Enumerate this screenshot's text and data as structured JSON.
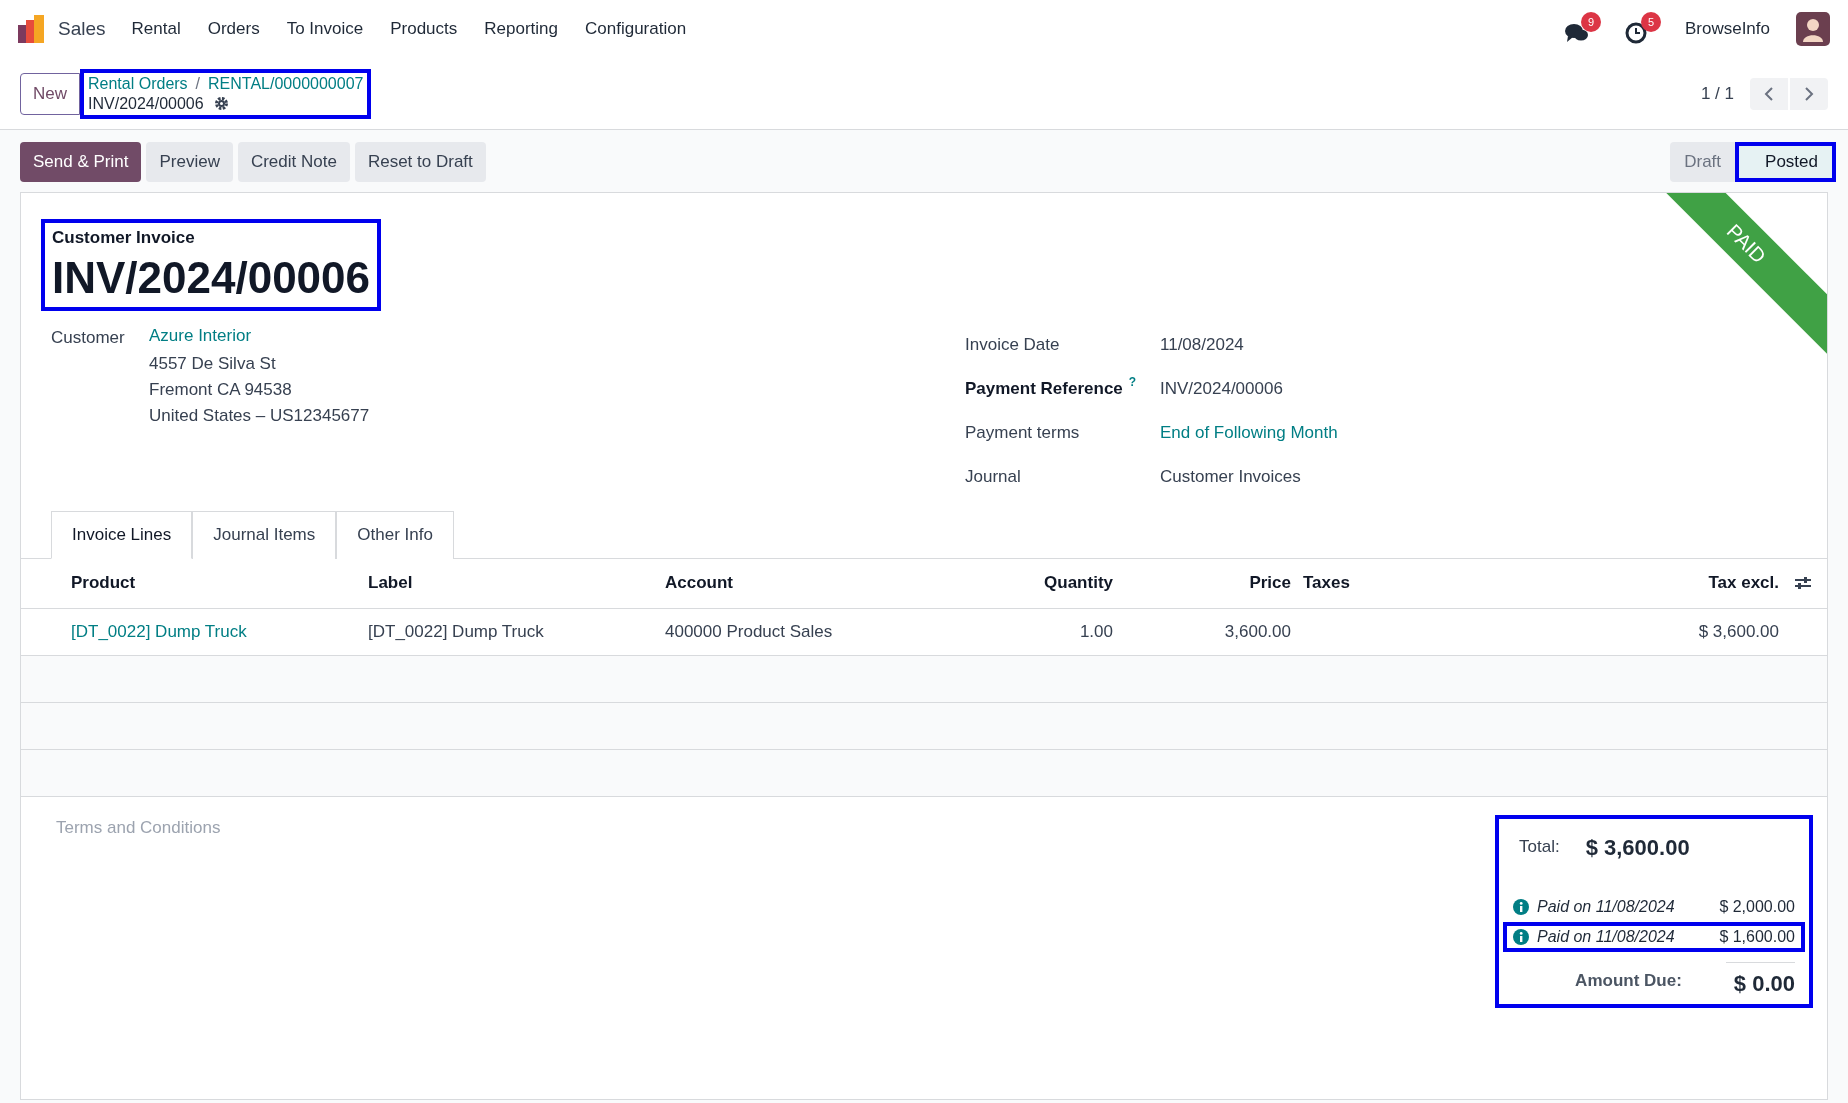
{
  "navbar": {
    "app": "Sales",
    "menu": [
      "Rental",
      "Orders",
      "To Invoice",
      "Products",
      "Reporting",
      "Configuration"
    ],
    "messages_count": "9",
    "activities_count": "5",
    "user": "BrowseInfo"
  },
  "control_panel": {
    "new_button": "New",
    "breadcrumbs": [
      "Rental Orders",
      "RENTAL/0000000007"
    ],
    "separator": "/",
    "current": "INV/2024/00006",
    "pager": "1 / 1"
  },
  "actions": [
    {
      "label": "Send & Print",
      "primary": true
    },
    {
      "label": "Preview",
      "primary": false
    },
    {
      "label": "Credit Note",
      "primary": false
    },
    {
      "label": "Reset to Draft",
      "primary": false
    }
  ],
  "status_bar": [
    {
      "label": "Draft",
      "selected": false
    },
    {
      "label": "Posted",
      "selected": true
    }
  ],
  "ribbon": "PAID",
  "document": {
    "type": "Customer Invoice",
    "number": "INV/2024/00006"
  },
  "customer": {
    "label": "Customer",
    "name": "Azure Interior",
    "address": [
      "4557 De Silva St",
      "Fremont CA 94538",
      "United States – US12345677"
    ]
  },
  "fields": [
    {
      "label": "Invoice Date",
      "value": "11/08/2024",
      "link": false,
      "required": false
    },
    {
      "label": "Payment Reference",
      "help": "?",
      "value": "INV/2024/00006",
      "link": false,
      "required": true
    },
    {
      "label": "Payment terms",
      "value": "End of Following Month",
      "link": true,
      "required": false
    },
    {
      "label": "Journal",
      "value": "Customer Invoices",
      "link": false,
      "required": false
    }
  ],
  "tabs": [
    {
      "label": "Invoice Lines",
      "selected": true
    },
    {
      "label": "Journal Items",
      "selected": false
    },
    {
      "label": "Other Info",
      "selected": false
    }
  ],
  "table": {
    "columns": [
      {
        "label": "Product",
        "kind": "text"
      },
      {
        "label": "Label",
        "kind": "text"
      },
      {
        "label": "Account",
        "kind": "text"
      },
      {
        "label": "Quantity",
        "kind": "number"
      },
      {
        "label": "Price",
        "kind": "number"
      },
      {
        "label": "Taxes",
        "kind": "text"
      },
      {
        "label": "Tax excl.",
        "kind": "number"
      }
    ],
    "rows": [
      {
        "product_link": true,
        "cells": [
          "[DT_0022] Dump Truck",
          "[DT_0022] Dump Truck",
          "400000 Product Sales",
          "1.00",
          "3,600.00",
          "",
          "$ 3,600.00"
        ]
      }
    ]
  },
  "terms_placeholder": "Terms and Conditions",
  "totals": {
    "total_label": "Total:",
    "total": "$ 3,600.00",
    "payments": [
      {
        "label": "Paid on 11/08/2024",
        "amount": "$ 2,000.00",
        "highlighted": false
      },
      {
        "label": "Paid on 11/08/2024",
        "amount": "$ 1,600.00",
        "highlighted": true
      }
    ],
    "due_label": "Amount Due:",
    "due": "$ 0.00"
  }
}
